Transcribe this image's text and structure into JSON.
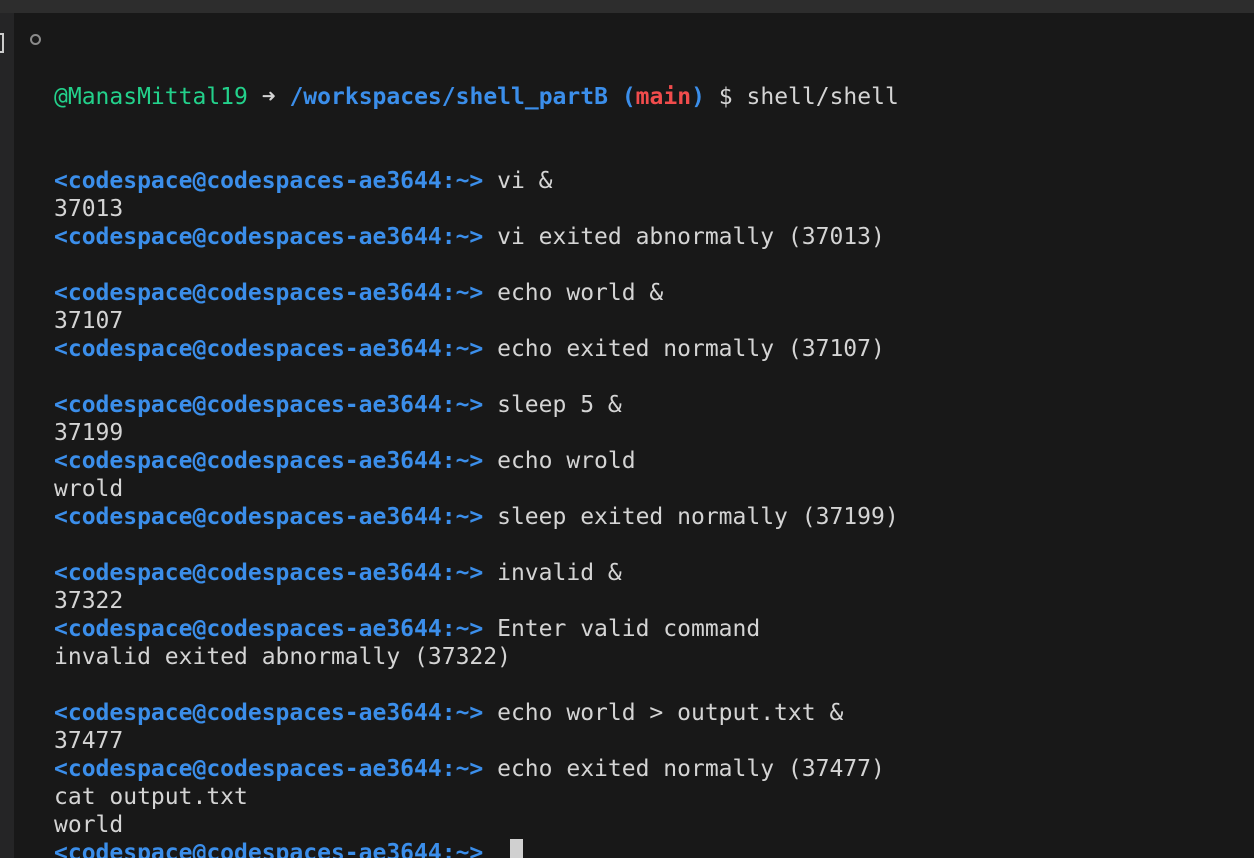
{
  "header": {
    "user": "@ManasMittal19",
    "arrow": "➜",
    "path": "/workspaces/shell_partB",
    "paren_open": "(",
    "branch": "main",
    "paren_close": ")",
    "dollar": "$",
    "command": "shell/shell"
  },
  "prompt": "<codespace@codespaces-ae3644:~>",
  "lines": [
    {
      "prompt": "<codespace@codespaces-ae3644:~>",
      "text": " vi &"
    },
    {
      "text": "37013"
    },
    {
      "prompt": "<codespace@codespaces-ae3644:~>",
      "text": " vi exited abnormally (37013)"
    },
    {
      "text": ""
    },
    {
      "prompt": "<codespace@codespaces-ae3644:~>",
      "text": " echo world &"
    },
    {
      "text": "37107"
    },
    {
      "prompt": "<codespace@codespaces-ae3644:~>",
      "text": " echo exited normally (37107)"
    },
    {
      "text": ""
    },
    {
      "prompt": "<codespace@codespaces-ae3644:~>",
      "text": " sleep 5 &"
    },
    {
      "text": "37199"
    },
    {
      "prompt": "<codespace@codespaces-ae3644:~>",
      "text": " echo wrold"
    },
    {
      "text": "wrold"
    },
    {
      "prompt": "<codespace@codespaces-ae3644:~>",
      "text": " sleep exited normally (37199)"
    },
    {
      "text": ""
    },
    {
      "prompt": "<codespace@codespaces-ae3644:~>",
      "text": " invalid &"
    },
    {
      "text": "37322"
    },
    {
      "prompt": "<codespace@codespaces-ae3644:~>",
      "text": " Enter valid command"
    },
    {
      "text": "invalid exited abnormally (37322)"
    },
    {
      "text": ""
    },
    {
      "prompt": "<codespace@codespaces-ae3644:~>",
      "text": " echo world > output.txt &"
    },
    {
      "text": "37477"
    },
    {
      "prompt": "<codespace@codespaces-ae3644:~>",
      "text": " echo exited normally (37477)"
    },
    {
      "text": "cat output.txt"
    },
    {
      "text": "world"
    },
    {
      "prompt": "<codespace@codespaces-ae3644:~>",
      "text": " "
    }
  ],
  "colors": {
    "background": "#181818",
    "prompt": "#3b8eea",
    "user": "#23d18b",
    "branch": "#f14c4c",
    "text": "#d4d4d4"
  }
}
